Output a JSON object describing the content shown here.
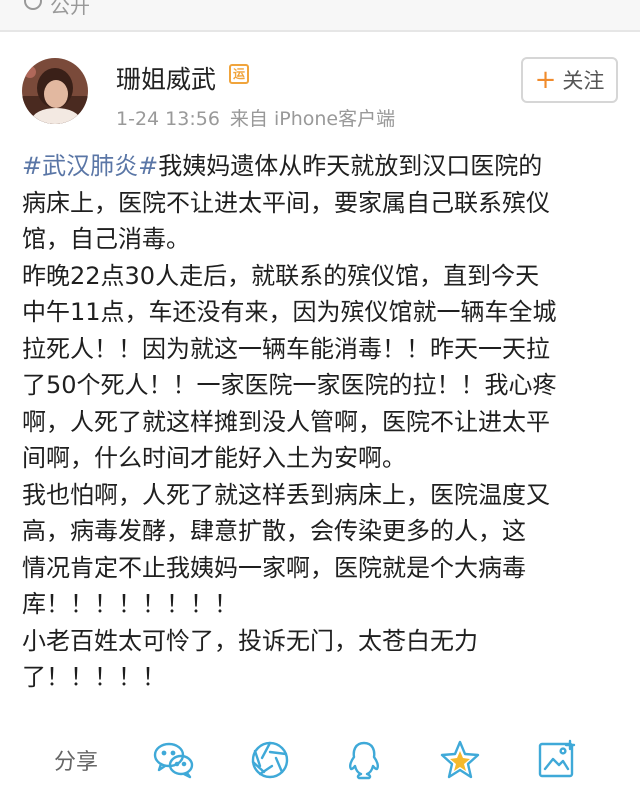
{
  "top": {
    "visibility": "公开"
  },
  "user": {
    "name": "珊姐威武",
    "badge": "运",
    "time": "1-24 13:56",
    "source": "来自 iPhone客户端"
  },
  "follow": {
    "plus": "+",
    "label": "关注"
  },
  "post": {
    "topic": "#武汉肺炎#",
    "lines": [
      "我姨妈遗体从昨天就放到汉口医院的",
      "病床上，医院不让进太平间，要家属自己联系殡仪",
      "馆，自己消毒。",
      "昨晚22点30人走后，就联系的殡仪馆，直到今天",
      "中午11点，车还没有来，因为殡仪馆就一辆车全城",
      "拉死人！！因为就这一辆车能消毒！！昨天一天拉",
      "了50个死人！！一家医院一家医院的拉！！我心疼",
      "啊，人死了就这样摊到没人管啊，医院不让进太平",
      "间啊，什么时间才能好入土为安啊。",
      "我也怕啊，人死了就这样丢到病床上，医院温度又",
      "高，病毒发酵，肆意扩散，会传染更多的人，这",
      "情况肯定不止我姨妈一家啊，医院就是个大病毒",
      "库！！！！！！！！",
      "小老百姓太可怜了，投诉无门，太苍白无力",
      "了！！！！！"
    ]
  },
  "share": {
    "label": "分享",
    "icons": [
      "wechat-icon",
      "moments-icon",
      "qq-icon",
      "qzone-icon",
      "image-icon"
    ],
    "color": "#3fa9d8",
    "star_fill": "#f5b92c"
  }
}
